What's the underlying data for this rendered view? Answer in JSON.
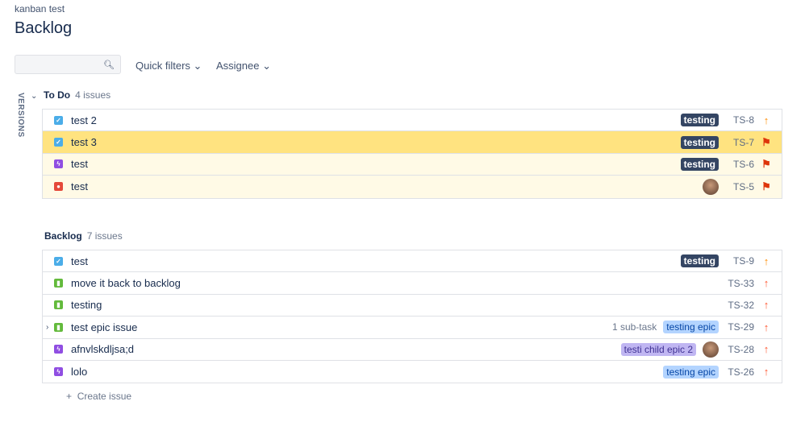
{
  "breadcrumb": "kanban test",
  "title": "Backlog",
  "toolbar": {
    "quick_filters": "Quick filters",
    "assignee": "Assignee"
  },
  "versions_label": "VERSIONS",
  "todo": {
    "name": "To Do",
    "count": "4 issues",
    "issues": [
      {
        "type": "task",
        "summary": "test 2",
        "label": "testing",
        "key": "TS-8",
        "priority": "up-orange"
      },
      {
        "type": "task",
        "summary": "test 3",
        "label": "testing",
        "key": "TS-7",
        "priority": "flag"
      },
      {
        "type": "epic",
        "summary": "test",
        "label": "testing",
        "key": "TS-6",
        "priority": "flag"
      },
      {
        "type": "bug",
        "summary": "test",
        "label": "",
        "key": "TS-5",
        "priority": "flag"
      }
    ]
  },
  "backlog": {
    "name": "Backlog",
    "count": "7 issues",
    "issues": [
      {
        "type": "task",
        "summary": "test",
        "label": "testing",
        "key": "TS-9",
        "priority": "up-orange"
      },
      {
        "type": "story",
        "summary": "move it back to backlog",
        "key": "TS-33",
        "priority": "up-red"
      },
      {
        "type": "story",
        "summary": "testing",
        "key": "TS-32",
        "priority": "up-red"
      },
      {
        "type": "story",
        "summary": "test epic issue",
        "subtasks": "1 sub-task",
        "epic": "testing epic",
        "key": "TS-29",
        "priority": "up-red"
      },
      {
        "type": "epic",
        "summary": "afnvlskdljsa;d",
        "epic": "testi child epic 2",
        "key": "TS-28",
        "priority": "up-red"
      },
      {
        "type": "epic",
        "summary": "lolo",
        "epic": "testing epic",
        "key": "TS-26",
        "priority": "up-red"
      }
    ]
  },
  "create_issue": "Create issue",
  "colors": {
    "task": "#4bade8",
    "epic": "#904ee2",
    "bug": "#e5493a",
    "story": "#63ba3c",
    "flag": "#de350b",
    "up_orange": "#ff8b00",
    "up_red": "#ff5630"
  }
}
